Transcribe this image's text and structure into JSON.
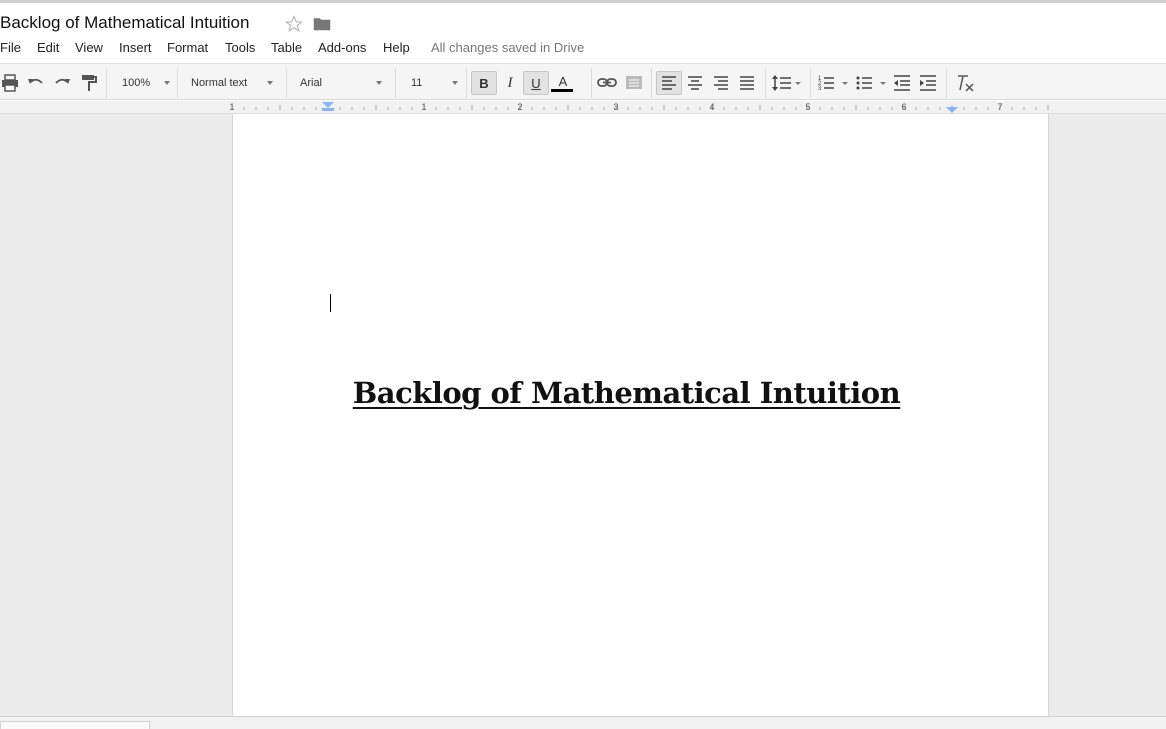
{
  "document": {
    "title": "Backlog of Mathematical Intuition",
    "heading": "Backlog of Mathematical Intuition"
  },
  "menus": [
    "File",
    "Edit",
    "View",
    "Insert",
    "Format",
    "Tools",
    "Table",
    "Add-ons",
    "Help"
  ],
  "save_status": "All changes saved in Drive",
  "toolbar": {
    "zoom": "100%",
    "style": "Normal text",
    "font": "Arial",
    "size": "11",
    "bold": "B",
    "italic": "I",
    "underline": "U",
    "text_color_letter": "A"
  },
  "ruler": {
    "labels": [
      "1",
      "1",
      "2",
      "3",
      "4",
      "5",
      "6",
      "7"
    ]
  },
  "icons": {
    "star": "star-icon",
    "folder": "folder-icon",
    "print": "print-icon",
    "undo": "undo-icon",
    "redo": "redo-icon",
    "paint_format": "paint-format-icon",
    "link": "link-icon",
    "comment": "comment-icon",
    "align_left": "align-left-icon",
    "align_center": "align-center-icon",
    "align_right": "align-right-icon",
    "justify": "justify-icon",
    "line_spacing": "line-spacing-icon",
    "numbered_list": "numbered-list-icon",
    "bulleted_list": "bulleted-list-icon",
    "decrease_indent": "decrease-indent-icon",
    "increase_indent": "increase-indent-icon",
    "clear_formatting": "clear-formatting-icon"
  },
  "colors": {
    "text_color_bar": "#000000",
    "indent_marker": "#8ab4f8"
  }
}
